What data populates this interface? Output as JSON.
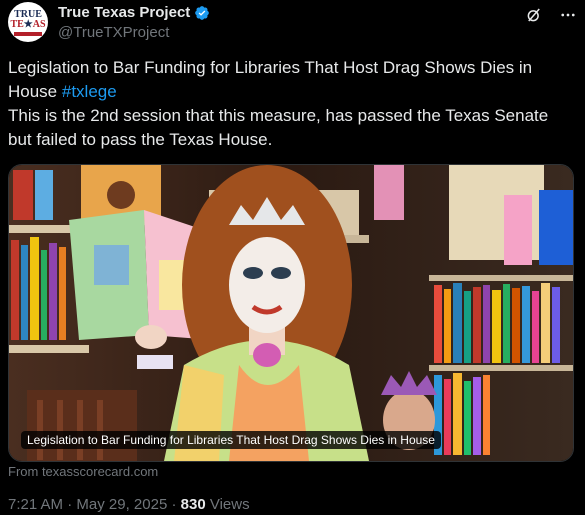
{
  "author": {
    "name": "True Texas Project",
    "handle": "@TrueTXProject",
    "avatar_text_top": "TRUE",
    "avatar_text_bottom_left": "TE",
    "avatar_text_bottom_right": "AS",
    "avatar_star": "★"
  },
  "post": {
    "line1": "Legislation to Bar Funding for Libraries That Host Drag Shows Dies in",
    "line2_prefix": "House ",
    "hashtag": "#txlege",
    "line3": "This is the 2nd session that this measure, has passed the Texas Senate",
    "line4": "but failed to pass the Texas House."
  },
  "media": {
    "caption": "Legislation to Bar Funding for Libraries That Host Drag Shows Dies in House",
    "source": "From texasscorecard.com"
  },
  "meta": {
    "time": "7:21 AM",
    "sep1": " · ",
    "date": "May 29, 2025",
    "sep2": " · ",
    "views_count": "830",
    "views_label": " Views"
  },
  "colors": {
    "accent": "#1d9bf0",
    "background": "#000000",
    "text": "#e7e9ea",
    "muted": "#71767b"
  },
  "icons": [
    "verified-badge-icon",
    "grok-icon",
    "more-options-icon"
  ]
}
